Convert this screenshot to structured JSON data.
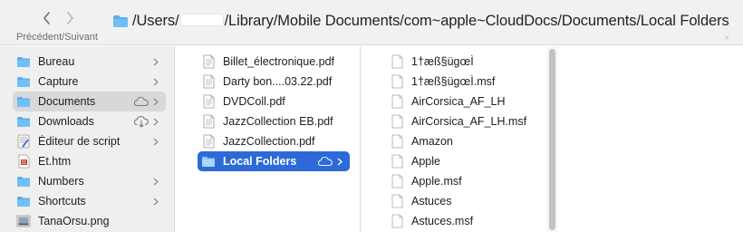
{
  "toolbar": {
    "nav_caption": "Précédent/Suivant",
    "path_part1": "/Users/",
    "path_part2": "/Library/Mobile Documents/com~apple~CloudDocs/Documents/Local Folders",
    "corner_mark": "x"
  },
  "sidebar": {
    "items": [
      {
        "label": "Bureau",
        "icon": "folder-icon"
      },
      {
        "label": "Capture",
        "icon": "folder-icon"
      },
      {
        "label": "Documents",
        "icon": "folder-icon",
        "badge": "icloud-icon"
      },
      {
        "label": "Downloads",
        "icon": "folder-icon",
        "badge": "icloud-download-icon"
      },
      {
        "label": "Éditeur de script",
        "icon": "script-editor-icon"
      },
      {
        "label": "Et.htm",
        "icon": "html-file-icon"
      },
      {
        "label": "Numbers",
        "icon": "folder-icon"
      },
      {
        "label": "Shortcuts",
        "icon": "folder-icon"
      },
      {
        "label": "TanaOrsu.png",
        "icon": "image-file-icon"
      }
    ]
  },
  "column2": {
    "items": [
      {
        "label": "Billet_électronique.pdf",
        "icon": "pdf-file-icon"
      },
      {
        "label": "Darty bon....03.22.pdf",
        "icon": "pdf-file-icon"
      },
      {
        "label": "DVDColl.pdf",
        "icon": "pdf-file-icon"
      },
      {
        "label": "JazzCollection EB.pdf",
        "icon": "pdf-file-icon"
      },
      {
        "label": "JazzCollection.pdf",
        "icon": "pdf-file-icon"
      },
      {
        "label": "Local Folders",
        "icon": "folder-icon",
        "badge": "icloud-icon"
      }
    ]
  },
  "column3": {
    "items": [
      {
        "label": "1†æß§ügœÌ",
        "icon": "document-icon"
      },
      {
        "label": "1†æß§ügœÌ.msf",
        "icon": "document-icon"
      },
      {
        "label": "AirCorsica_AF_LH",
        "icon": "document-icon"
      },
      {
        "label": "AirCorsica_AF_LH.msf",
        "icon": "document-icon"
      },
      {
        "label": "Amazon",
        "icon": "document-icon"
      },
      {
        "label": "Apple",
        "icon": "document-icon"
      },
      {
        "label": "Apple.msf",
        "icon": "document-icon"
      },
      {
        "label": "Astuces",
        "icon": "document-icon"
      },
      {
        "label": "Astuces.msf",
        "icon": "document-icon"
      }
    ]
  },
  "colors": {
    "selection_blue": "#2d6ad7",
    "folder_blue": "#5aaef2",
    "sidebar_bg": "#f0efee"
  }
}
